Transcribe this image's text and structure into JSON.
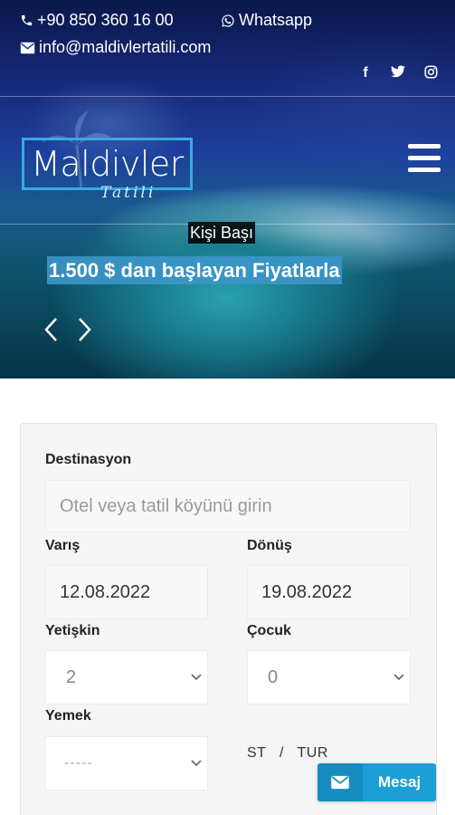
{
  "topbar": {
    "phone": "+90 850 360 16 00",
    "whatsapp": "Whatsapp",
    "email": "info@maldivlertatili.com",
    "socials": [
      "facebook-icon",
      "twitter-icon",
      "instagram-icon"
    ]
  },
  "logo": {
    "main": "Maldivler",
    "sub": "Tatili"
  },
  "hero": {
    "kicker": "Kişi Başı",
    "headline": "1.500 $ dan başlayan Fiyatlarla"
  },
  "form": {
    "destination": {
      "label": "Destinasyon",
      "placeholder": "Otel veya tatil köyünü girin"
    },
    "arrival": {
      "label": "Varış",
      "value": "12.08.2022"
    },
    "return": {
      "label": "Dönüş",
      "value": "19.08.2022"
    },
    "adults": {
      "label": "Yetişkin",
      "value": "2"
    },
    "children": {
      "label": "Çocuk",
      "value": "0"
    },
    "meal": {
      "label": "Yemek",
      "value": "-----"
    },
    "tour_toggle": {
      "st": "ST",
      "sep": "/",
      "tur": "TUR"
    }
  },
  "message_button": {
    "label": "Mesaj"
  },
  "colors": {
    "accent": "#1c9ed7",
    "price_highlight": "#3c96c8",
    "logo_border": "#3aa8e0"
  }
}
